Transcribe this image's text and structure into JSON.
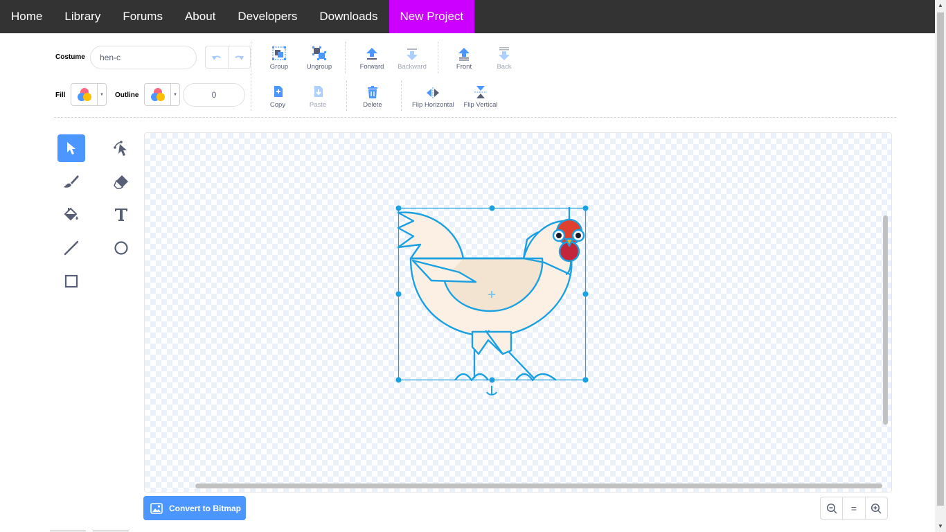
{
  "nav": {
    "items": [
      "Home",
      "Library",
      "Forums",
      "About",
      "Developers",
      "Downloads",
      "New Project"
    ],
    "active": "New Project",
    "active_color": "#cc00ff"
  },
  "costume": {
    "label": "Costume",
    "name": "hen-c"
  },
  "toolbar": {
    "group": "Group",
    "ungroup": "Ungroup",
    "forward": "Forward",
    "backward": "Backward",
    "front": "Front",
    "back": "Back",
    "copy": "Copy",
    "paste": "Paste",
    "delete": "Delete",
    "flip_horizontal": "Flip Horizontal",
    "flip_vertical": "Flip Vertical"
  },
  "style": {
    "fill_label": "Fill",
    "outline_label": "Outline",
    "outline_width": "0"
  },
  "tools": [
    "select-tool",
    "reshape-tool",
    "brush-tool",
    "eraser-tool",
    "fill-tool",
    "text-tool",
    "line-tool",
    "circle-tool",
    "rectangle-tool"
  ],
  "selected_tool": "select-tool",
  "convert_button": "Convert to Bitmap",
  "zoom": {
    "reset": "="
  },
  "colors": {
    "accent": "#4c97ff",
    "nav_bg": "#333333",
    "hen_outline": "#1ba1e2",
    "hen_body": "#fbf0e3"
  }
}
